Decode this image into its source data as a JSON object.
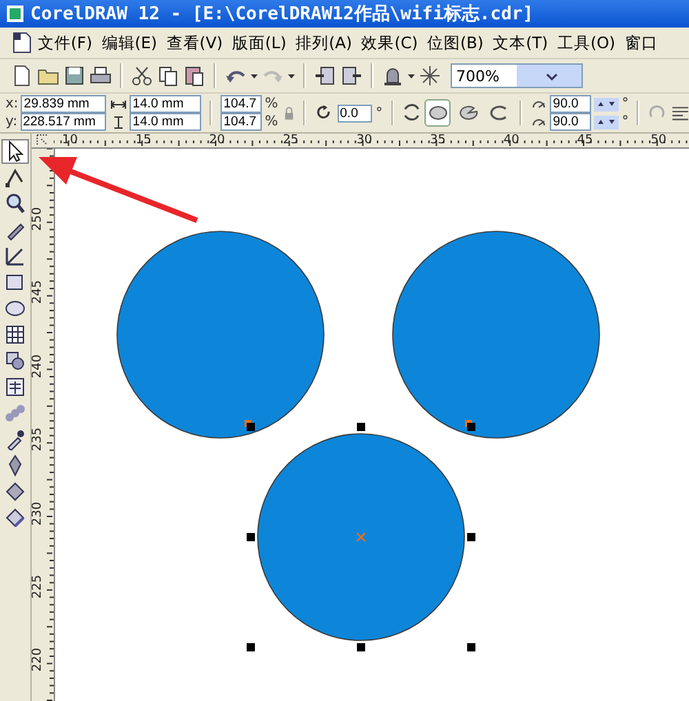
{
  "window": {
    "title": "CorelDRAW 12 - [E:\\CorelDRAW12作品\\wifi标志.cdr]"
  },
  "menu": [
    {
      "label": "文件(F)"
    },
    {
      "label": "编辑(E)"
    },
    {
      "label": "查看(V)"
    },
    {
      "label": "版面(L)"
    },
    {
      "label": "排列(A)"
    },
    {
      "label": "效果(C)"
    },
    {
      "label": "位图(B)"
    },
    {
      "label": "文本(T)"
    },
    {
      "label": "工具(O)"
    },
    {
      "label": "窗口"
    }
  ],
  "standard_toolbar": {
    "zoom": "700%"
  },
  "property_bar": {
    "x_label": "x:",
    "x": "29.839 mm",
    "y_label": "y:",
    "y": "228.517 mm",
    "width": "14.0 mm",
    "height": "14.0 mm",
    "scale": [
      {
        "value": "104.7",
        "unit": "%"
      },
      {
        "value": "104.7",
        "unit": "%"
      }
    ],
    "rotation": {
      "value": "0.0",
      "unit": "°"
    },
    "ellipse_modes": [
      {
        "kind": "ellipse",
        "selected": true
      },
      {
        "kind": "pie",
        "selected": false
      },
      {
        "kind": "arc",
        "selected": false
      }
    ],
    "angles": [
      {
        "value": "90.0",
        "unit": "°"
      },
      {
        "value": "90.0",
        "unit": "°"
      }
    ]
  },
  "toolbox": [
    {
      "kind": "pick",
      "selected": true
    },
    {
      "kind": "shape",
      "selected": false
    },
    {
      "kind": "zoom",
      "selected": false
    },
    {
      "kind": "freehand",
      "selected": false
    },
    {
      "kind": "dimension",
      "selected": false
    },
    {
      "kind": "rectangle",
      "selected": false
    },
    {
      "kind": "ellipse",
      "selected": false
    },
    {
      "kind": "table",
      "selected": false
    },
    {
      "kind": "basic",
      "selected": false
    },
    {
      "kind": "text",
      "selected": false
    },
    {
      "kind": "blend",
      "selected": false
    },
    {
      "kind": "eyedropper",
      "selected": false
    },
    {
      "kind": "outline",
      "selected": false
    },
    {
      "kind": "fill",
      "selected": false
    },
    {
      "kind": "interactive_fill",
      "selected": false
    }
  ],
  "rulers": {
    "horizontal": [
      "10",
      "15",
      "20",
      "25",
      "30",
      "35",
      "40",
      "45",
      "50"
    ],
    "vertical": [
      "250",
      "245",
      "240",
      "235",
      "230",
      "225",
      "220"
    ]
  },
  "canvas": {
    "shapes": [
      {
        "kind": "circle",
        "selected": false
      },
      {
        "kind": "circle",
        "selected": false
      },
      {
        "kind": "circle",
        "selected": true
      }
    ]
  }
}
